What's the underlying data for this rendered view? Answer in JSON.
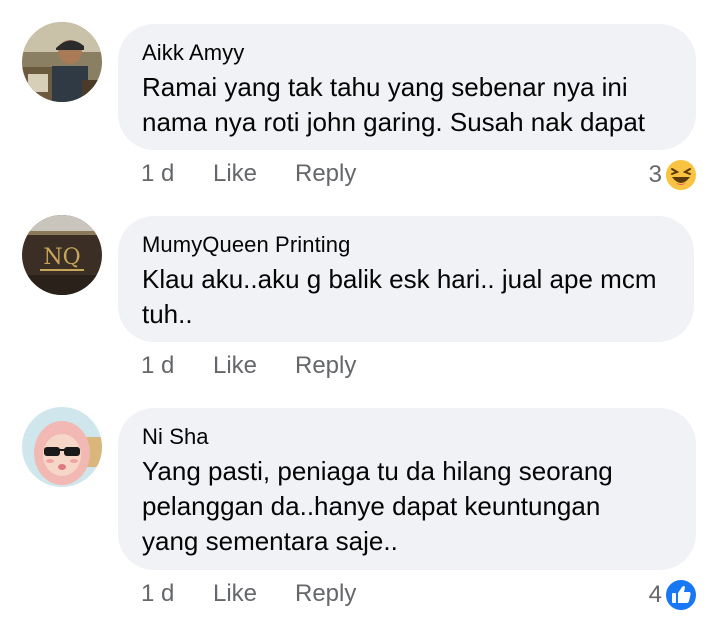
{
  "comments": [
    {
      "author": "Aikk Amyy",
      "text": "Ramai yang tak tahu yang sebenar nya ini\nnama nya roti john garing. Susah nak dapat",
      "time": "1 d",
      "like_label": "Like",
      "reply_label": "Reply",
      "reaction_count": "3",
      "reaction_icon": "haha-emoji-icon",
      "avatar": "person-with-cap-avatar"
    },
    {
      "author": "MumyQueen Printing",
      "text": "Klau aku..aku g balik esk hari.. jual ape mcm\ntuh..",
      "time": "1 d",
      "like_label": "Like",
      "reply_label": "Reply",
      "avatar": "shop-logo-avatar",
      "avatar_logo_text": "NQ"
    },
    {
      "author": "Ni Sha",
      "text": "Yang pasti, peniaga tu da hilang seorang\npelanggan da..hanye dapat keuntungan\nyang sementara saje..",
      "time": "1 d",
      "like_label": "Like",
      "reply_label": "Reply",
      "reaction_count": "4",
      "reaction_icon": "like-thumb-icon",
      "avatar": "cartoon-girl-hijab-avatar"
    }
  ],
  "colors": {
    "bubble": "#f0f2f5",
    "meta_text": "#65676b",
    "like_blue": "#1877f2",
    "haha_yellow": "#f7c341"
  }
}
